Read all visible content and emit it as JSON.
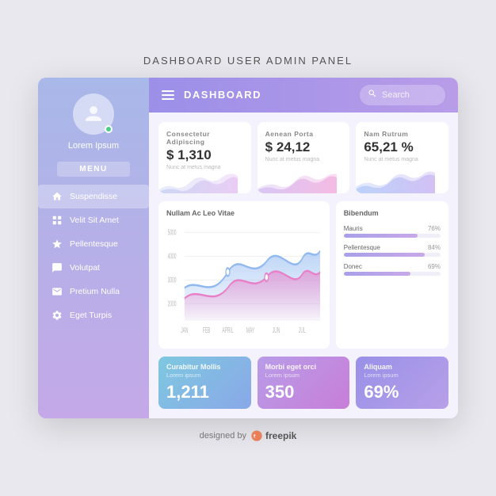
{
  "page": {
    "title": "DASHBOARD USER ADMIN PANEL",
    "footer": "designed by",
    "footer_brand": "freepik"
  },
  "topbar": {
    "title": "DASHBOARD",
    "search_placeholder": "Search"
  },
  "sidebar": {
    "user_name": "Lorem Ipsum",
    "menu_label": "MENU",
    "nav_items": [
      {
        "label": "Suspendisse",
        "icon": "home",
        "active": true
      },
      {
        "label": "Velit Sit Amet",
        "icon": "grid",
        "active": false
      },
      {
        "label": "Pellentesque",
        "icon": "star",
        "active": false
      },
      {
        "label": "Volutpat",
        "icon": "chat",
        "active": false
      },
      {
        "label": "Pretium Nulla",
        "icon": "mail",
        "active": false
      },
      {
        "label": "Eget Turpis",
        "icon": "settings",
        "active": false
      }
    ]
  },
  "stat_cards": [
    {
      "title": "Consectetur Adipiscing",
      "value": "$ 1,310",
      "sub": "Nunc at metus magna"
    },
    {
      "title": "Aenean Porta",
      "value": "$ 24,12",
      "sub": "Nunc at metus magna"
    },
    {
      "title": "Nam Rutrum",
      "value": "65,21 %",
      "sub": "Nunc at metus magna"
    }
  ],
  "chart": {
    "title": "Nullam Ac Leo Vitae",
    "x_labels": [
      "JAN",
      "FEB",
      "APRIL",
      "MAY",
      "JUN",
      "JUL"
    ],
    "y_labels": [
      "5000",
      "4000",
      "3000",
      "2000"
    ]
  },
  "progress_bars": {
    "title": "Bibendum",
    "items": [
      {
        "label": "Mauris",
        "pct": 76
      },
      {
        "label": "Pellentesque",
        "pct": 84
      },
      {
        "label": "Donec",
        "pct": 69
      }
    ]
  },
  "bottom_cards": [
    {
      "title": "Curabitur Mollis",
      "sub": "Lorem ipsum",
      "value": "1,211",
      "color": "blue"
    },
    {
      "title": "Morbi eget orci",
      "sub": "Lorem ipsum",
      "value": "350",
      "color": "purple"
    },
    {
      "title": "Aliquam",
      "sub": "Lorem ipsum",
      "value": "69%",
      "color": "violet"
    }
  ]
}
